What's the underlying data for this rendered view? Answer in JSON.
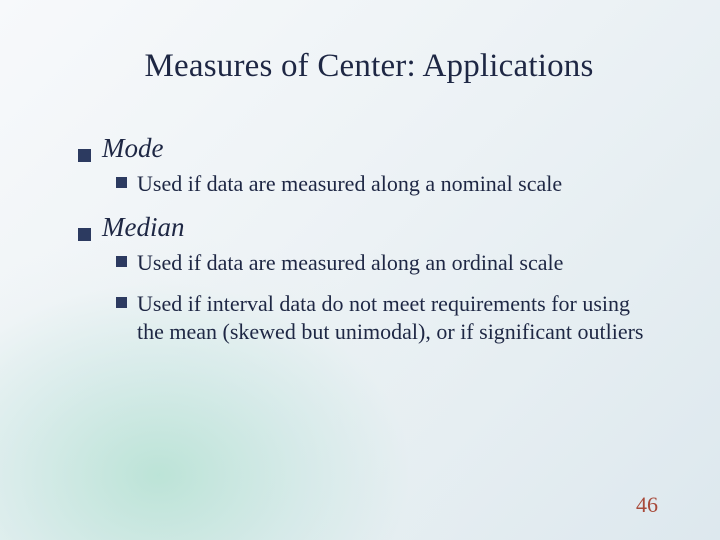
{
  "title": "Measures of Center: Applications",
  "sections": [
    {
      "heading": "Mode",
      "items": [
        "Used if data are measured along a nominal scale"
      ]
    },
    {
      "heading": "Median",
      "items": [
        "Used if data are measured along an ordinal scale",
        "Used if interval data do not meet requirements for using the mean (skewed but unimodal), or if significant outliers"
      ]
    }
  ],
  "page_number": "46"
}
